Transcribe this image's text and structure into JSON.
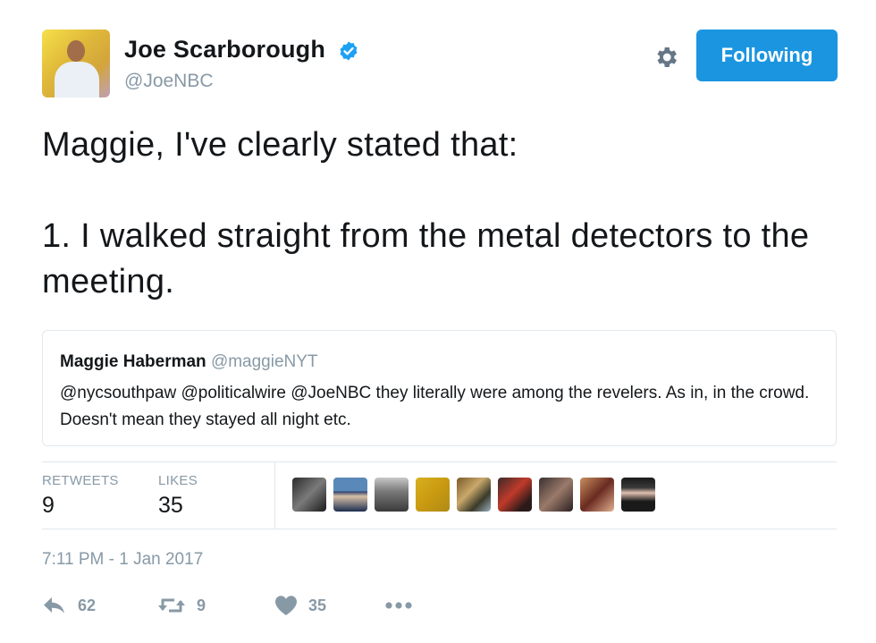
{
  "author": {
    "name": "Joe Scarborough",
    "handle": "@JoeNBC",
    "verified_color": "#1da1f2"
  },
  "follow_button": {
    "label": "Following",
    "color": "#1b95e0"
  },
  "settings": {
    "icon": "gear-icon"
  },
  "tweet": {
    "text": "Maggie, I've clearly stated that:\n\n1. I walked straight from the metal detectors to the meeting."
  },
  "quoted_tweet": {
    "name": "Maggie Haberman",
    "handle": "@maggieNYT",
    "text": "@nycsouthpaw @politicalwire @JoeNBC they literally were among the revelers. As in, in the crowd. Doesn't mean they stayed all night etc."
  },
  "stats": {
    "retweets_label": "RETWEETS",
    "retweets_value": "9",
    "likes_label": "LIKES",
    "likes_value": "35"
  },
  "likers_count_shown": 9,
  "timestamp": "7:11 PM - 1 Jan 2017",
  "actions": {
    "reply_count": "62",
    "retweet_count": "9",
    "like_count": "35"
  }
}
